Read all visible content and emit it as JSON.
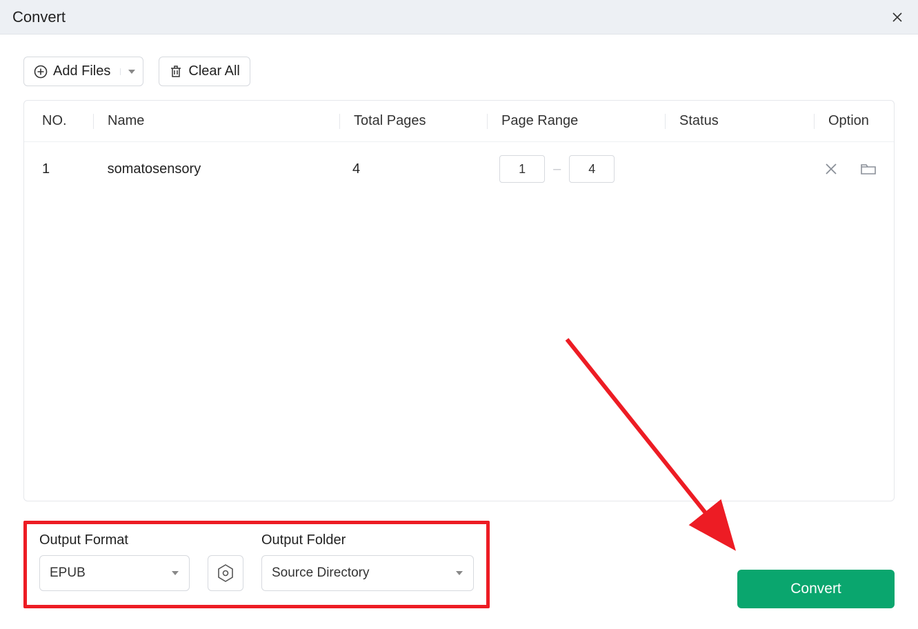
{
  "titlebar": {
    "title": "Convert"
  },
  "toolbar": {
    "add_files_label": "Add Files",
    "clear_all_label": "Clear All"
  },
  "table": {
    "headers": {
      "no": "NO.",
      "name": "Name",
      "total_pages": "Total Pages",
      "page_range": "Page Range",
      "status": "Status",
      "option": "Option"
    },
    "rows": [
      {
        "no": "1",
        "name": "somatosensory",
        "total_pages": "4",
        "range_from": "1",
        "range_to": "4",
        "status": ""
      }
    ]
  },
  "footer": {
    "output_format_label": "Output Format",
    "output_format_value": "EPUB",
    "output_folder_label": "Output Folder",
    "output_folder_value": "Source Directory",
    "convert_label": "Convert"
  }
}
